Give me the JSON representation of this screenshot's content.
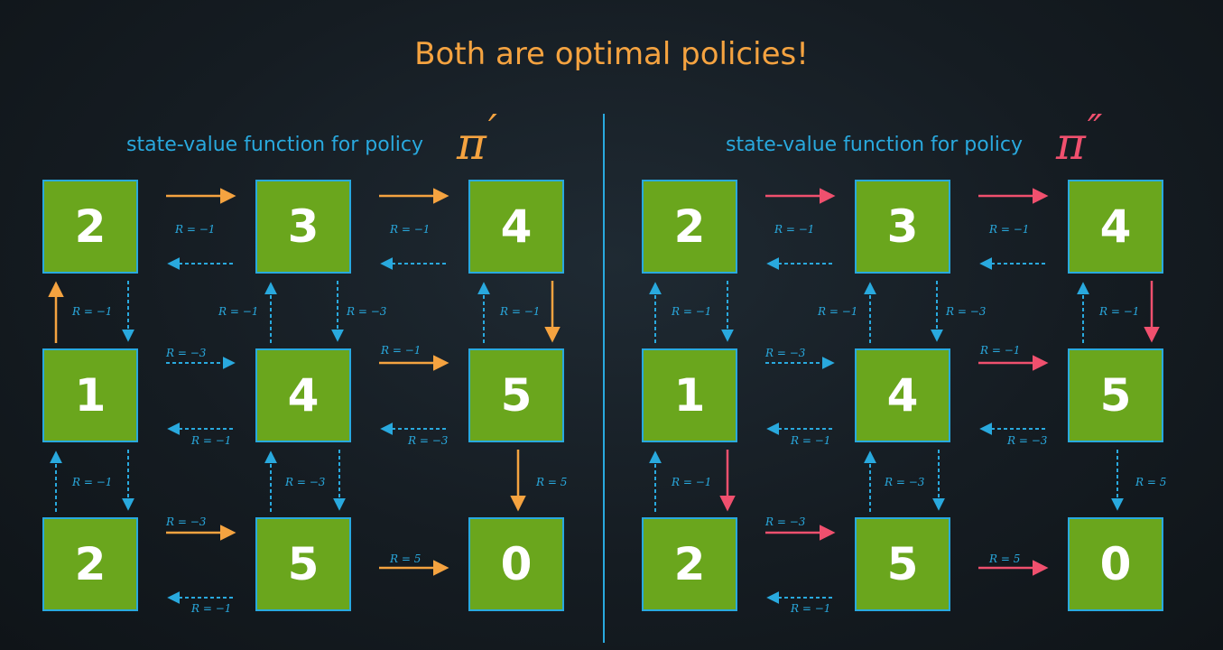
{
  "title": "Both are optimal policies!",
  "colors": {
    "accent_orange": "#f5a340",
    "accent_pink": "#f0506e",
    "accent_blue": "#29a9de",
    "state_green": "#6aa61d"
  },
  "panels": [
    {
      "title": "state-value function for policy",
      "policy_symbol": "π",
      "policy_prime": "′",
      "policy_color": "#f5a340",
      "grid": [
        [
          "2",
          "3",
          "4"
        ],
        [
          "1",
          "4",
          "5"
        ],
        [
          "2",
          "5",
          "0"
        ]
      ],
      "rewards": {
        "r0_h0": "R = −1",
        "r0_h1": "R = −1",
        "r1_h0": "R = −3",
        "r1_h0b": "R = −1",
        "r1_h1": "R = −1",
        "r1_h1b": "R = −3",
        "r2_h0": "R = −3",
        "r2_h0b": "R = −1",
        "r2_h1": "R = 5",
        "v0_c0": "R = −1",
        "v0_c1a": "R = −1",
        "v0_c1b": "R = −3",
        "v0_c2": "R = −1",
        "v1_c0": "R = −1",
        "v1_c1": "R = −3",
        "v1_c2": "R = 5"
      }
    },
    {
      "title": "state-value function for policy",
      "policy_symbol": "π",
      "policy_prime": "″",
      "policy_color": "#f0506e",
      "grid": [
        [
          "2",
          "3",
          "4"
        ],
        [
          "1",
          "4",
          "5"
        ],
        [
          "2",
          "5",
          "0"
        ]
      ],
      "rewards": {
        "r0_h0": "R = −1",
        "r0_h1": "R = −1",
        "r1_h0": "R = −3",
        "r1_h0b": "R = −1",
        "r1_h1": "R = −1",
        "r1_h1b": "R = −3",
        "r2_h0": "R = −3",
        "r2_h0b": "R = −1",
        "r2_h1": "R = 5",
        "v0_c0": "R = −1",
        "v0_c1a": "R = −1",
        "v0_c1b": "R = −3",
        "v0_c2": "R = −1",
        "v1_c0": "R = −1",
        "v1_c1": "R = −3",
        "v1_c2": "R = 5"
      }
    }
  ]
}
